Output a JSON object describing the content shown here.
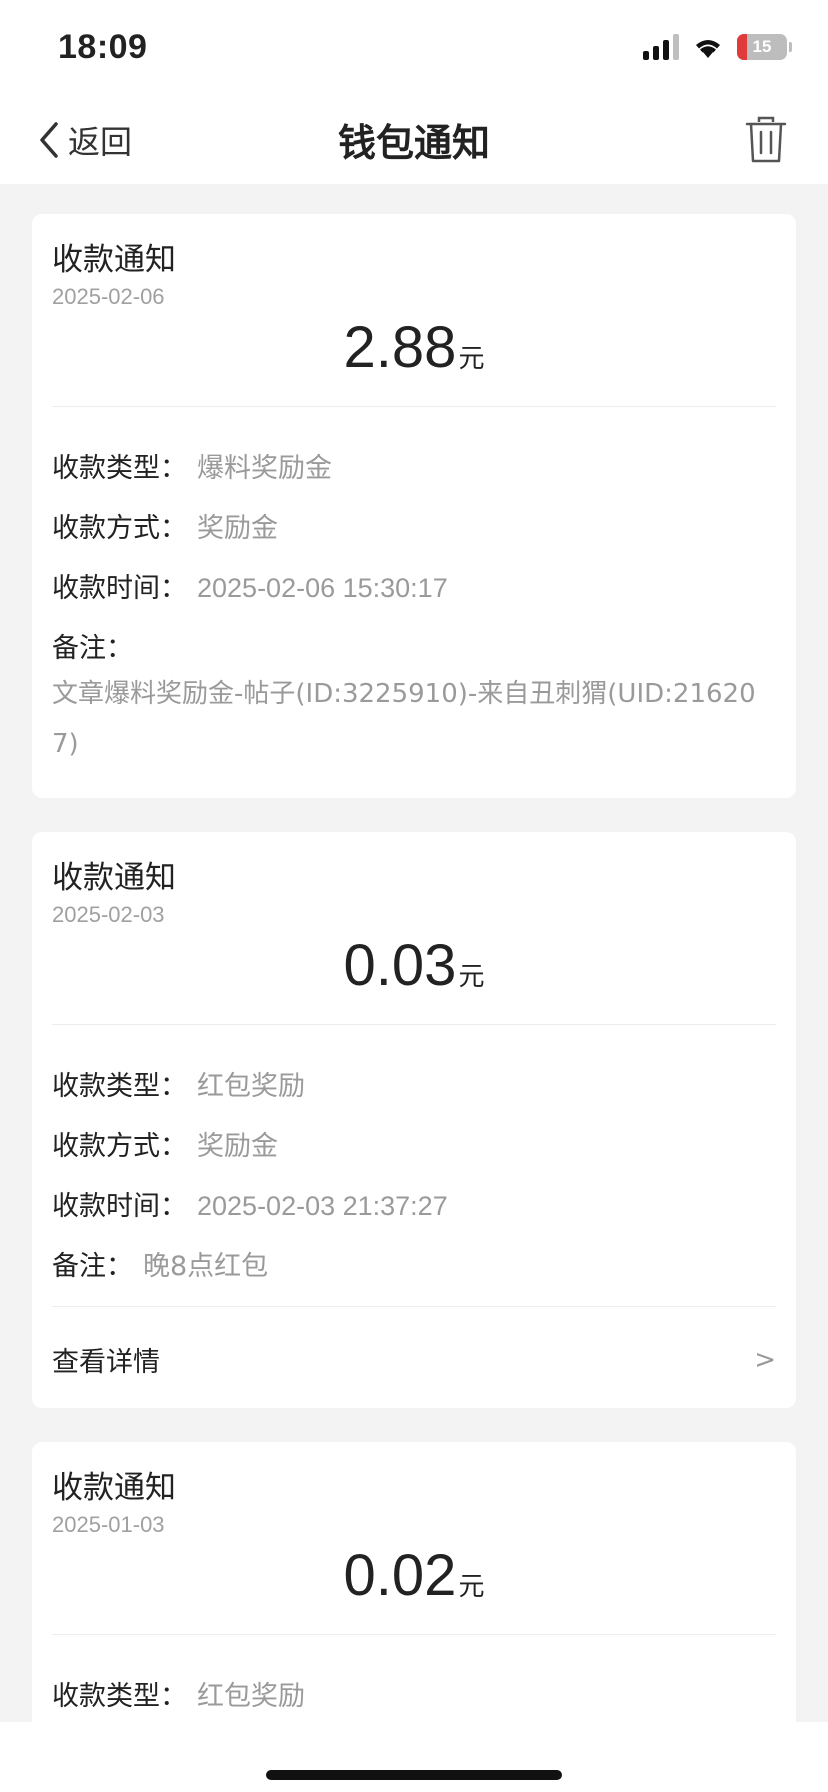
{
  "status_bar": {
    "time": "18:09",
    "battery": "15"
  },
  "nav": {
    "back_label": "返回",
    "title": "钱包通知"
  },
  "cards": [
    {
      "title": "收款通知",
      "date": "2025-02-06",
      "amount": "2.88",
      "unit": "元",
      "type_label": "收款类型：",
      "type_value": "爆料奖励金",
      "method_label": "收款方式：",
      "method_value": "奖励金",
      "time_label": "收款时间：",
      "time_value": "2025-02-06 15:30:17",
      "remark_label": "备注：",
      "remark_value": "文章爆料奖励金-帖子(ID:3225910)-来自丑刺猬(UID:216207)"
    },
    {
      "title": "收款通知",
      "date": "2025-02-03",
      "amount": "0.03",
      "unit": "元",
      "type_label": "收款类型：",
      "type_value": "红包奖励",
      "method_label": "收款方式：",
      "method_value": "奖励金",
      "time_label": "收款时间：",
      "time_value": "2025-02-03 21:37:27",
      "remark_label": "备注：",
      "remark_value": "晚8点红包",
      "details_label": "查看详情",
      "details_arrow": ">"
    },
    {
      "title": "收款通知",
      "date": "2025-01-03",
      "amount": "0.02",
      "unit": "元",
      "type_label": "收款类型：",
      "type_value": "红包奖励"
    }
  ],
  "colors": {
    "background": "#f3f3f3",
    "card": "#ffffff",
    "text": "#222222",
    "muted": "#9a9a9a",
    "battery_low": "#e03b3b"
  }
}
